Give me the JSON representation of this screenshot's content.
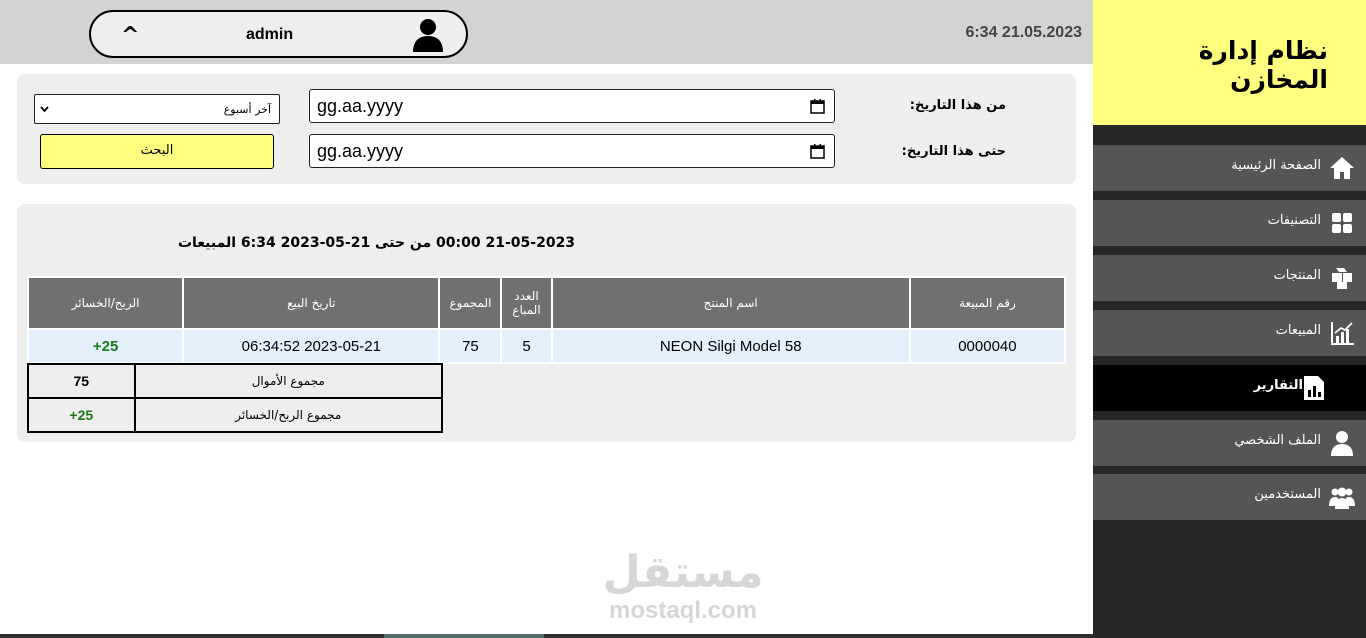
{
  "header": {
    "username": "admin",
    "caret": "^",
    "datetime": "6:34 21.05.2023"
  },
  "sidebar": {
    "title": "نظام إدارة المخازن",
    "items": [
      {
        "label": "الصفحة الرئيسية",
        "icon": "home-icon",
        "active": false
      },
      {
        "label": "التصنيفات",
        "icon": "grid-icon",
        "active": false
      },
      {
        "label": "المنتجات",
        "icon": "boxes-icon",
        "active": false
      },
      {
        "label": "المبيعات",
        "icon": "sales-chart-icon",
        "active": false
      },
      {
        "label": "التقارير",
        "icon": "report-icon",
        "active": true
      },
      {
        "label": "الملف الشخصي",
        "icon": "user-icon",
        "active": false
      },
      {
        "label": "المستخدمين",
        "icon": "users-icon",
        "active": false
      }
    ]
  },
  "filters": {
    "from_label": "من هذا التاريخ:",
    "to_label": "حتى هذا التاريخ:",
    "from_value": "gg.aa.yyyy",
    "to_value": "gg.aa.yyyy",
    "period_selected": "آخر أسبوع",
    "search_label": "البحث"
  },
  "report": {
    "title": "21-05-2023 00:00 من حتى 21-05-2023 6:34 المبيعات",
    "columns": [
      "رقم المبيعة",
      "اسم المنتج",
      "العدد المباع",
      "المجموع",
      "تاريخ البيع",
      "الربح/الخسائر"
    ],
    "rows": [
      {
        "sale_no": "0000040",
        "product": "NEON Silgi Model 58",
        "qty": "5",
        "total": "75",
        "date": "2023-05-21 06:34:52",
        "profit": "+25"
      }
    ],
    "summary": [
      {
        "label": "مجموع الأموال",
        "value": "75"
      },
      {
        "label": "مجموع الربح/الخسائر",
        "value": "+25"
      }
    ]
  },
  "watermark": {
    "logo_text": "مستقل",
    "url": "mostaql.com"
  },
  "colors": {
    "brand_yellow": "#ffff7f",
    "sidebar_bg": "#272727",
    "nav_item_bg": "#555555",
    "header_bg": "#d3d3d3",
    "table_header_bg": "#707070",
    "row_bg": "#e3f0fc",
    "profit_green": "#1b7a1b"
  }
}
